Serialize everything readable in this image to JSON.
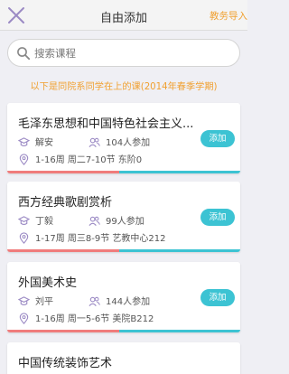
{
  "header": {
    "title": "自由添加",
    "import_label": "教务导入"
  },
  "search": {
    "placeholder": "搜索课程",
    "value": ""
  },
  "notice": "以下是同院系同学在上的课(2014年春季学期)",
  "colors": {
    "accent": "#3cc3d3",
    "orange": "#f0a030",
    "pink": "#f07c7c",
    "icon_purple": "#9b8ac4"
  },
  "courses": [
    {
      "name": "毛泽东思想和中国特色社会主义...",
      "teacher": "解安",
      "count": "104人参加",
      "schedule": "1-16周 周二7-10节 东阶0",
      "add_label": "添加"
    },
    {
      "name": "西方经典歌剧赏析",
      "teacher": "丁毅",
      "count": "99人参加",
      "schedule": "1-17周 周三8-9节 艺教中心212",
      "add_label": "添加"
    },
    {
      "name": "外国美术史",
      "teacher": "刘平",
      "count": "144人参加",
      "schedule": "1-16周 周一5-6节 美院B212",
      "add_label": "添加"
    },
    {
      "name": "中国传统装饰艺术"
    }
  ]
}
